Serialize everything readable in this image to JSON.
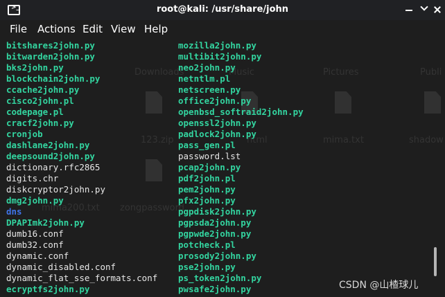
{
  "window": {
    "title": "root@kali: /usr/share/john",
    "icon": "terminal-icon"
  },
  "menu": [
    "File",
    "Actions",
    "Edit",
    "View",
    "Help"
  ],
  "desktop_ghost": [
    {
      "text": "Downloads"
    },
    {
      "text": "Music"
    },
    {
      "text": "Pictures"
    },
    {
      "text": "Publi"
    },
    {
      "text": "123.zip"
    },
    {
      "text": "html"
    },
    {
      "text": "mima.txt"
    },
    {
      "text": "shadow"
    },
    {
      "text": "mima200.txt"
    },
    {
      "text": "zongpassword"
    }
  ],
  "terminal": {
    "colors": {
      "exec": "#33d5a0",
      "file": "#e8e8e8",
      "dir": "#3f74e8",
      "background": "#1e1e1e"
    },
    "left_column": [
      {
        "text": "bitshares2john.py",
        "type": "exec"
      },
      {
        "text": "bitwarden2john.py",
        "type": "exec"
      },
      {
        "text": "bks2john.py",
        "type": "exec"
      },
      {
        "text": "blockchain2john.py",
        "type": "exec"
      },
      {
        "text": "ccache2john.py",
        "type": "exec"
      },
      {
        "text": "cisco2john.pl",
        "type": "exec"
      },
      {
        "text": "codepage.pl",
        "type": "exec"
      },
      {
        "text": "cracf2john.py",
        "type": "exec"
      },
      {
        "text": "cronjob",
        "type": "exec"
      },
      {
        "text": "dashlane2john.py",
        "type": "exec"
      },
      {
        "text": "deepsound2john.py",
        "type": "exec"
      },
      {
        "text": "dictionary.rfc2865",
        "type": "file"
      },
      {
        "text": "digits.chr",
        "type": "file"
      },
      {
        "text": "diskcryptor2john.py",
        "type": "file"
      },
      {
        "text": "dmg2john.py",
        "type": "exec"
      },
      {
        "text": "dns",
        "type": "dir"
      },
      {
        "text": "DPAPImk2john.py",
        "type": "exec"
      },
      {
        "text": "dumb16.conf",
        "type": "file"
      },
      {
        "text": "dumb32.conf",
        "type": "file"
      },
      {
        "text": "dynamic.conf",
        "type": "file"
      },
      {
        "text": "dynamic_disabled.conf",
        "type": "file"
      },
      {
        "text": "dynamic_flat_sse_formats.conf",
        "type": "file"
      },
      {
        "text": "ecryptfs2john.py",
        "type": "exec"
      }
    ],
    "right_column": [
      {
        "text": "mozilla2john.py",
        "type": "exec"
      },
      {
        "text": "multibit2john.py",
        "type": "exec"
      },
      {
        "text": "neo2john.py",
        "type": "exec"
      },
      {
        "text": "netntlm.pl",
        "type": "exec"
      },
      {
        "text": "netscreen.py",
        "type": "exec"
      },
      {
        "text": "office2john.py",
        "type": "exec"
      },
      {
        "text": "openbsd_softraid2john.py",
        "type": "exec"
      },
      {
        "text": "openssl2john.py",
        "type": "exec"
      },
      {
        "text": "padlock2john.py",
        "type": "exec"
      },
      {
        "text": "pass_gen.pl",
        "type": "exec"
      },
      {
        "text": "password.lst",
        "type": "file"
      },
      {
        "text": "pcap2john.py",
        "type": "exec"
      },
      {
        "text": "pdf2john.pl",
        "type": "exec"
      },
      {
        "text": "pem2john.py",
        "type": "exec"
      },
      {
        "text": "pfx2john.py",
        "type": "exec"
      },
      {
        "text": "pgpdisk2john.py",
        "type": "exec"
      },
      {
        "text": "pgpsda2john.py",
        "type": "exec"
      },
      {
        "text": "pgpwde2john.py",
        "type": "exec"
      },
      {
        "text": "potcheck.pl",
        "type": "exec"
      },
      {
        "text": "prosody2john.py",
        "type": "exec"
      },
      {
        "text": "pse2john.py",
        "type": "exec"
      },
      {
        "text": "ps_token2john.py",
        "type": "exec"
      },
      {
        "text": "pwsafe2john.py",
        "type": "exec"
      }
    ]
  },
  "watermark": "CSDN @山楂球儿"
}
